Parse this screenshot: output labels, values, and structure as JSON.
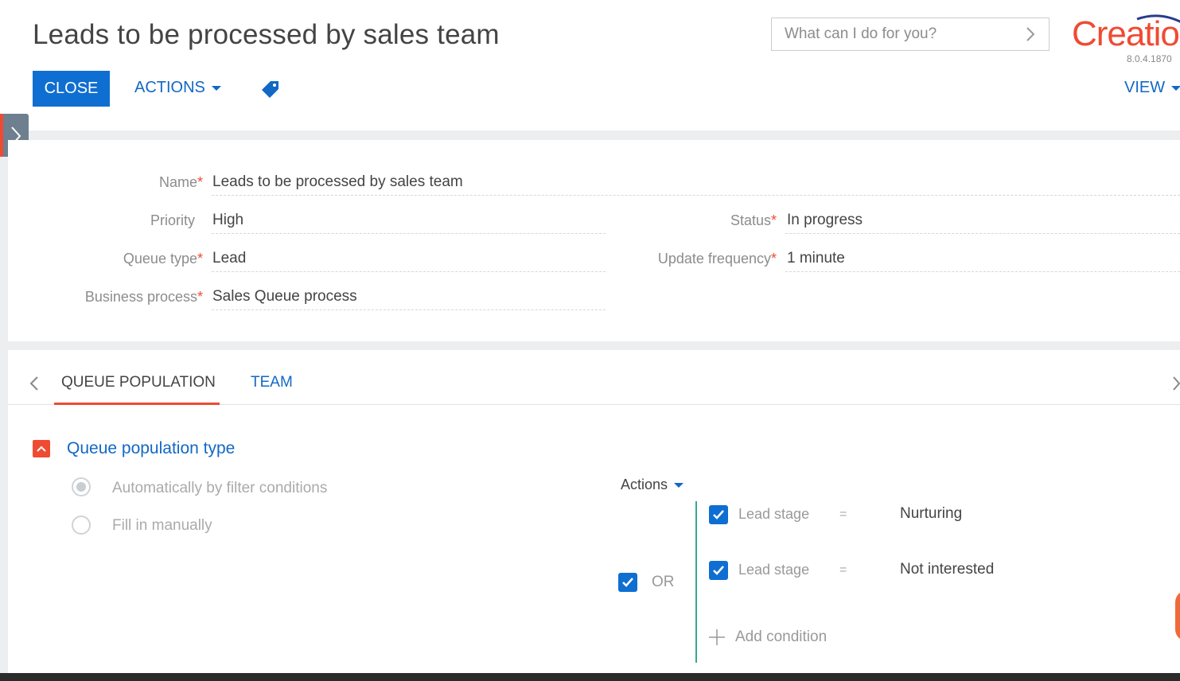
{
  "header": {
    "title": "Leads to be processed by sales team",
    "search_placeholder": "What can I do for you?",
    "logo": "Creatio",
    "version": "8.0.4.1870",
    "close_label": "CLOSE",
    "actions_label": "ACTIONS",
    "view_label": "VIEW",
    "accent_color": "#0f6ed1",
    "brand_color": "#ef4b33"
  },
  "fields": {
    "name": {
      "label": "Name",
      "value": "Leads to be processed by sales team",
      "required": true
    },
    "priority": {
      "label": "Priority",
      "value": "High",
      "required": false
    },
    "status": {
      "label": "Status",
      "value": "In progress",
      "required": true
    },
    "queue_type": {
      "label": "Queue type",
      "value": "Lead",
      "required": true
    },
    "update_frequency": {
      "label": "Update frequency",
      "value": "1 minute",
      "required": true
    },
    "business_process": {
      "label": "Business process",
      "value": "Sales Queue process",
      "required": true
    }
  },
  "tabs": [
    {
      "label": "QUEUE POPULATION",
      "active": true
    },
    {
      "label": "TEAM",
      "active": false
    }
  ],
  "queue_population": {
    "group_title": "Queue population type",
    "options": [
      {
        "label": "Automatically by filter conditions",
        "checked": true
      },
      {
        "label": "Fill in manually",
        "checked": false
      }
    ],
    "filter": {
      "actions_label": "Actions",
      "group_operator": "OR",
      "conditions": [
        {
          "column": "Lead stage",
          "operator": "=",
          "value": "Nurturing",
          "enabled": true
        },
        {
          "column": "Lead stage",
          "operator": "=",
          "value": "Not interested",
          "enabled": true
        }
      ],
      "add_condition_label": "Add condition"
    }
  },
  "icons": {
    "search_arrow": "chevron-right-icon",
    "tag": "tag-icon",
    "sidebar_toggle": "chevron-right-icon",
    "group_toggle": "chevron-up-icon",
    "add": "plus-icon",
    "check": "checkmark-icon"
  }
}
